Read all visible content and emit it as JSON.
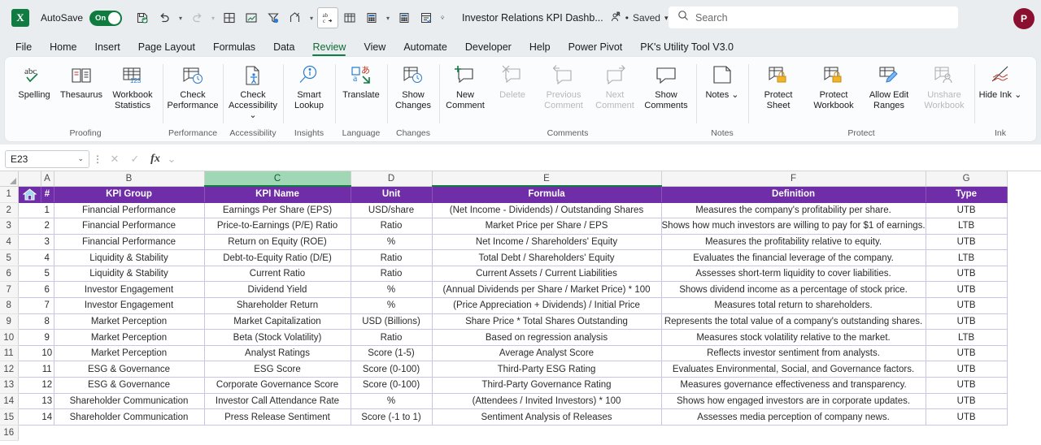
{
  "titlebar": {
    "app_logo": "excel-logo",
    "logo_letter": "X",
    "autosave_label": "AutoSave",
    "autosave_state": "On",
    "document_title": "Investor Relations KPI Dashb...",
    "save_state": "Saved",
    "separator_dot": "•",
    "search_placeholder": "Search",
    "avatar_initial": "P",
    "quick_access": [
      {
        "name": "save-icon",
        "label": "Save"
      },
      {
        "name": "undo-icon",
        "label": "Undo"
      },
      {
        "name": "redo-icon",
        "label": "Redo"
      },
      {
        "name": "borders-icon",
        "label": "Borders"
      },
      {
        "name": "chart-icon",
        "label": "Chart"
      },
      {
        "name": "filter-icon",
        "label": "Filter"
      },
      {
        "name": "share-icon",
        "label": "Share"
      },
      {
        "name": "spelling-icon",
        "label": "Spelling"
      },
      {
        "name": "table-icon",
        "label": "Table"
      },
      {
        "name": "calculator-icon",
        "label": "Calculator"
      },
      {
        "name": "calculator2-icon",
        "label": "Calculator"
      },
      {
        "name": "form-icon",
        "label": "Form"
      },
      {
        "name": "customize-toolbar-icon",
        "label": "Customize Quick Access Toolbar"
      }
    ]
  },
  "tabs": [
    {
      "label": "File",
      "active": false
    },
    {
      "label": "Home",
      "active": false
    },
    {
      "label": "Insert",
      "active": false
    },
    {
      "label": "Page Layout",
      "active": false
    },
    {
      "label": "Formulas",
      "active": false
    },
    {
      "label": "Data",
      "active": false
    },
    {
      "label": "Review",
      "active": true
    },
    {
      "label": "View",
      "active": false
    },
    {
      "label": "Automate",
      "active": false
    },
    {
      "label": "Developer",
      "active": false
    },
    {
      "label": "Help",
      "active": false
    },
    {
      "label": "Power Pivot",
      "active": false
    },
    {
      "label": "PK's Utility Tool V3.0",
      "active": false
    }
  ],
  "ribbon": {
    "groups": [
      {
        "name": "Proofing",
        "buttons": [
          {
            "label": "Spelling",
            "icon": "abc-check-icon",
            "disabled": false,
            "caret": false
          },
          {
            "label": "Thesaurus",
            "icon": "book-icon",
            "disabled": false,
            "caret": false
          },
          {
            "label": "Workbook Statistics",
            "icon": "workbook-stats-icon",
            "disabled": false,
            "caret": false
          }
        ]
      },
      {
        "name": "Performance",
        "buttons": [
          {
            "label": "Check Performance",
            "icon": "check-performance-icon",
            "disabled": false,
            "caret": false
          }
        ]
      },
      {
        "name": "Accessibility",
        "buttons": [
          {
            "label": "Check Accessibility",
            "icon": "check-accessibility-icon",
            "disabled": false,
            "caret": true
          }
        ]
      },
      {
        "name": "Insights",
        "buttons": [
          {
            "label": "Smart Lookup",
            "icon": "smart-lookup-icon",
            "disabled": false,
            "caret": false
          }
        ]
      },
      {
        "name": "Language",
        "buttons": [
          {
            "label": "Translate",
            "icon": "translate-icon",
            "disabled": false,
            "caret": false
          }
        ]
      },
      {
        "name": "Changes",
        "buttons": [
          {
            "label": "Show Changes",
            "icon": "show-changes-icon",
            "disabled": false,
            "caret": false
          }
        ]
      },
      {
        "name": "Comments",
        "buttons": [
          {
            "label": "New Comment",
            "icon": "new-comment-icon",
            "disabled": false,
            "caret": false
          },
          {
            "label": "Delete",
            "icon": "delete-comment-icon",
            "disabled": true,
            "caret": false
          },
          {
            "label": "Previous Comment",
            "icon": "previous-comment-icon",
            "disabled": true,
            "caret": false
          },
          {
            "label": "Next Comment",
            "icon": "next-comment-icon",
            "disabled": true,
            "caret": false
          },
          {
            "label": "Show Comments",
            "icon": "show-comments-icon",
            "disabled": false,
            "caret": false
          }
        ]
      },
      {
        "name": "Notes",
        "buttons": [
          {
            "label": "Notes",
            "icon": "notes-icon",
            "disabled": false,
            "caret": true
          }
        ]
      },
      {
        "name": "Protect",
        "buttons": [
          {
            "label": "Protect Sheet",
            "icon": "protect-sheet-icon",
            "disabled": false,
            "caret": false
          },
          {
            "label": "Protect Workbook",
            "icon": "protect-workbook-icon",
            "disabled": false,
            "caret": false
          },
          {
            "label": "Allow Edit Ranges",
            "icon": "allow-edit-ranges-icon",
            "disabled": false,
            "caret": false
          },
          {
            "label": "Unshare Workbook",
            "icon": "unshare-workbook-icon",
            "disabled": true,
            "caret": false
          }
        ]
      },
      {
        "name": "Ink",
        "buttons": [
          {
            "label": "Hide Ink",
            "icon": "hide-ink-icon",
            "disabled": false,
            "caret": true
          }
        ]
      }
    ]
  },
  "formula_bar": {
    "name_box_value": "E23",
    "cancel_icon": "cancel-icon",
    "enter_icon": "enter-icon",
    "fx_label": "fx",
    "formula_value": ""
  },
  "grid": {
    "column_headers": [
      "A",
      "B",
      "C",
      "D",
      "E",
      "F",
      "G"
    ],
    "selected_column": "C",
    "home_icon": "home-icon",
    "row_numbers": [
      "1",
      "2",
      "3",
      "4",
      "5",
      "6",
      "7",
      "8",
      "9",
      "10",
      "11",
      "12",
      "13",
      "14",
      "15",
      "16"
    ],
    "header_row": [
      "#",
      "KPI Group",
      "KPI Name",
      "Unit",
      "Formula",
      "Definition",
      "Type"
    ],
    "rows": [
      [
        "1",
        "Financial Performance",
        "Earnings Per Share (EPS)",
        "USD/share",
        "(Net Income - Dividends) / Outstanding Shares",
        "Measures the company's profitability per share.",
        "UTB"
      ],
      [
        "2",
        "Financial Performance",
        "Price-to-Earnings (P/E) Ratio",
        "Ratio",
        "Market Price per Share / EPS",
        "Shows how much investors are willing to pay for $1 of earnings.",
        "LTB"
      ],
      [
        "3",
        "Financial Performance",
        "Return on Equity (ROE)",
        "%",
        "Net Income / Shareholders' Equity",
        "Measures the profitability relative to equity.",
        "UTB"
      ],
      [
        "4",
        "Liquidity & Stability",
        "Debt-to-Equity Ratio (D/E)",
        "Ratio",
        "Total Debt / Shareholders' Equity",
        "Evaluates the financial leverage of the company.",
        "LTB"
      ],
      [
        "5",
        "Liquidity & Stability",
        "Current Ratio",
        "Ratio",
        "Current Assets / Current Liabilities",
        "Assesses short-term liquidity to cover liabilities.",
        "UTB"
      ],
      [
        "6",
        "Investor Engagement",
        "Dividend Yield",
        "%",
        "(Annual Dividends per Share / Market Price) * 100",
        "Shows dividend income as a percentage of stock price.",
        "UTB"
      ],
      [
        "7",
        "Investor Engagement",
        "Shareholder Return",
        "%",
        "(Price Appreciation + Dividends) / Initial Price",
        "Measures total return to shareholders.",
        "UTB"
      ],
      [
        "8",
        "Market Perception",
        "Market Capitalization",
        "USD (Billions)",
        "Share Price * Total Shares Outstanding",
        "Represents the total value of a company's outstanding shares.",
        "UTB"
      ],
      [
        "9",
        "Market Perception",
        "Beta (Stock Volatility)",
        "Ratio",
        "Based on regression analysis",
        "Measures stock volatility relative to the market.",
        "LTB"
      ],
      [
        "10",
        "Market Perception",
        "Analyst Ratings",
        "Score (1-5)",
        "Average Analyst Score",
        "Reflects investor sentiment from analysts.",
        "UTB"
      ],
      [
        "11",
        "ESG & Governance",
        "ESG Score",
        "Score (0-100)",
        "Third-Party ESG Rating",
        "Evaluates Environmental, Social, and Governance factors.",
        "UTB"
      ],
      [
        "12",
        "ESG & Governance",
        "Corporate Governance Score",
        "Score (0-100)",
        "Third-Party Governance Rating",
        "Measures governance effectiveness and transparency.",
        "UTB"
      ],
      [
        "13",
        "Shareholder Communication",
        "Investor Call Attendance Rate",
        "%",
        "(Attendees / Invited Investors) * 100",
        "Shows how engaged investors are in corporate updates.",
        "UTB"
      ],
      [
        "14",
        "Shareholder Communication",
        "Press Release Sentiment",
        "Score (-1 to 1)",
        "Sentiment Analysis of Releases",
        "Assesses media perception of company news.",
        "UTB"
      ]
    ]
  },
  "colors": {
    "header_purple": "#6f2da8",
    "excel_green": "#107c41",
    "selected_col_green": "#a0d8b6",
    "grid_line": "#c9c4e8",
    "avatar_red": "#8b0f2e"
  }
}
